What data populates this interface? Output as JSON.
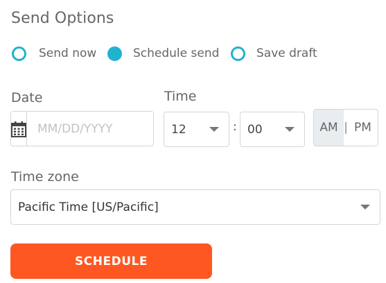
{
  "title": "Send Options",
  "send_mode": {
    "options": [
      {
        "label": "Send now",
        "checked": false
      },
      {
        "label": "Schedule send",
        "checked": true
      },
      {
        "label": "Save draft",
        "checked": false
      }
    ]
  },
  "date": {
    "label": "Date",
    "placeholder": "MM/DD/YYYY",
    "value": "",
    "icon": "calendar-icon"
  },
  "time": {
    "label": "Time",
    "hour": "12",
    "separator": ":",
    "minute": "00",
    "am_label": "AM",
    "pm_label": "PM",
    "divider": "|",
    "selected_period": "AM"
  },
  "timezone": {
    "label": "Time zone",
    "value": "Pacific Time [US/Pacific]"
  },
  "submit": {
    "label": "SCHEDULE"
  },
  "colors": {
    "accent": "#1fb3cf",
    "button": "#ff5722",
    "active_toggle": "#e9edf0"
  }
}
